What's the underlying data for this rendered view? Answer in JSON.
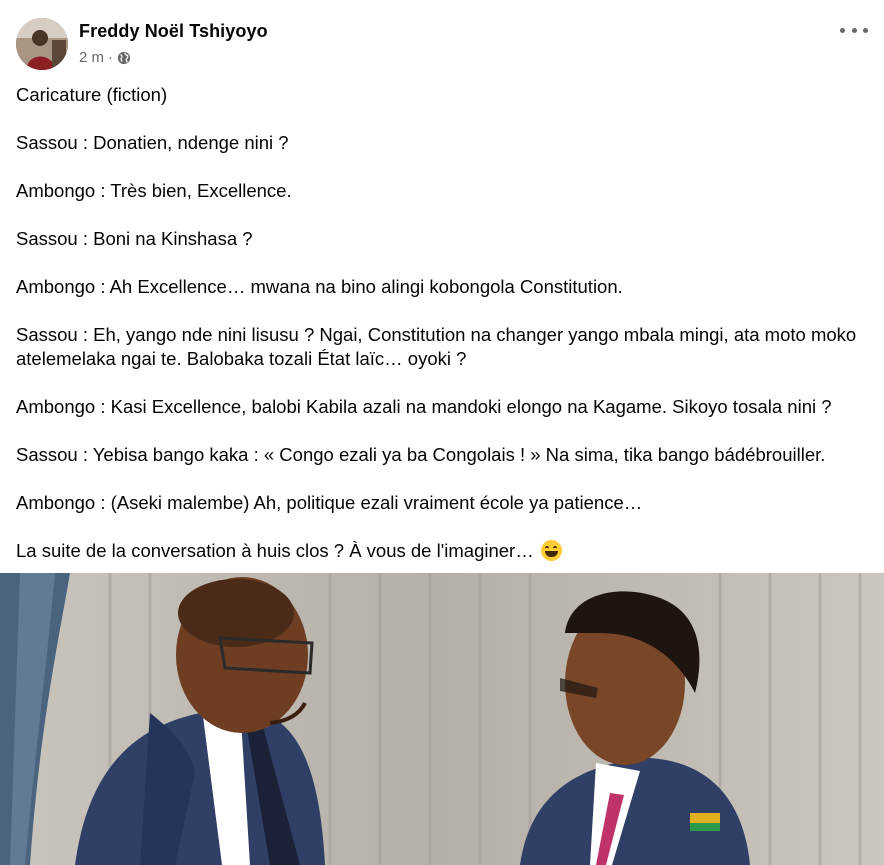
{
  "post": {
    "author": "Freddy Noël Tshiyoyo",
    "time": "2 m",
    "separator": "·",
    "privacy_icon": "globe-icon",
    "more_icon": "more-options-icon",
    "paragraphs": [
      "Caricature (fiction)",
      "Sassou : Donatien, ndenge nini ?",
      "Ambongo : Très bien, Excellence.",
      "Sassou : Boni na Kinshasa ?",
      "Ambongo : Ah Excellence… mwana na bino alingi kobongola Constitution.",
      "Sassou : Eh, yango nde nini lisusu ? Ngai, Constitution na changer yango mbala mingi, ata moto moko atelemelaka ngai te. Balobaka tozali État laïc… oyoki ?",
      "Ambongo : Kasi Excellence, balobi Kabila azali na mandoki elongo na Kagame. Sikoyo tosala nini ?",
      "Sassou : Yebisa bango kaka : « Congo ezali ya ba Congolais ! » Na sima, tika bango bádébrouiller.",
      "Ambongo : (Aseki malembe) Ah, politique ezali vraiment école ya patience…"
    ],
    "last_paragraph": "La suite de la conversation à huis clos ? À vous de l'imaginer…",
    "emoji_icon": "grinning-face-icon"
  },
  "colors": {
    "text": "#050505",
    "secondary": "#65676b",
    "suit": "#2f3f66"
  }
}
